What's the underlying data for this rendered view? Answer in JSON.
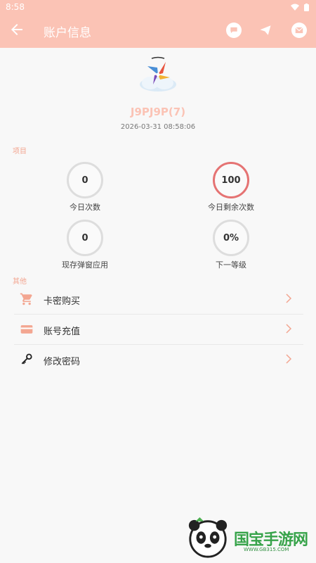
{
  "status_bar": {
    "time": "8:58"
  },
  "app_bar": {
    "title": "账户信息",
    "back_icon": "arrow-left-icon",
    "actions": [
      "chat-icon",
      "send-icon",
      "mail-icon"
    ]
  },
  "profile": {
    "username": "J9PJ9P(7)",
    "timestamp": "2026-03-31 08:58:06"
  },
  "sections": {
    "items_label": "项目",
    "other_label": "其他"
  },
  "stats": [
    {
      "value": "0",
      "label": "今日次数"
    },
    {
      "value": "100",
      "label": "今日剩余次数"
    },
    {
      "value": "0",
      "label": "现存弹窗应用"
    },
    {
      "value": "0%",
      "label": "下一等级"
    }
  ],
  "menu": [
    {
      "label": "卡密购买",
      "icon": "cart-icon"
    },
    {
      "label": "账号充值",
      "icon": "credit-card-icon"
    },
    {
      "label": "修改密码",
      "icon": "key-icon"
    }
  ],
  "watermark": {
    "brand": "国宝手游网",
    "url": "WWW.GB315.COM"
  },
  "colors": {
    "accent": "#fbc3b5",
    "highlight_ring": "#e57373",
    "section_text": "#f3a691"
  }
}
